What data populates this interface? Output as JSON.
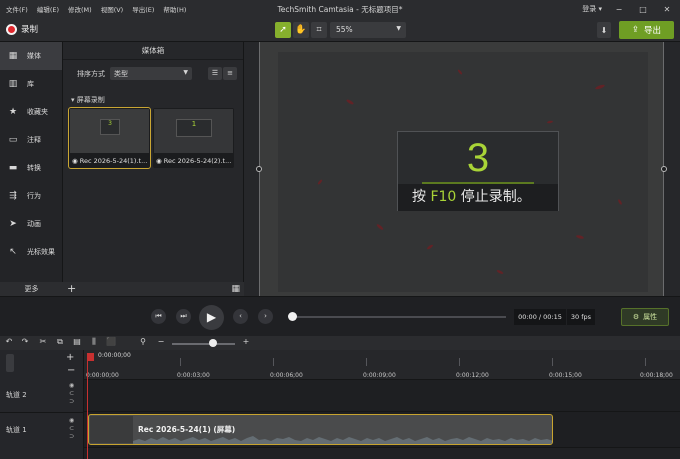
{
  "titlebar": {
    "menu": [
      "文件(F)",
      "编辑(E)",
      "修改(M)",
      "视图(V)",
      "导出(E)",
      "帮助(H)"
    ],
    "title": "TechSmith Camtasia - 无标题项目*",
    "login": "登录",
    "login_caret": "▾",
    "window_buttons": [
      "−",
      "□",
      "✕"
    ]
  },
  "toolbar": {
    "record_label": "录制",
    "zoom_value": "55%",
    "download_icon": "⬇",
    "export_label": "导出",
    "export_icon": "⇪"
  },
  "leftnav": {
    "items": [
      {
        "label": "媒体",
        "icon": "film-icon",
        "glyph": "▦"
      },
      {
        "label": "库",
        "icon": "library-icon",
        "glyph": "▥"
      },
      {
        "label": "收藏夹",
        "icon": "star-icon",
        "glyph": "★"
      },
      {
        "label": "注释",
        "icon": "callout-icon",
        "glyph": "▭"
      },
      {
        "label": "转换",
        "icon": "transition-icon",
        "glyph": "▬"
      },
      {
        "label": "行为",
        "icon": "behavior-icon",
        "glyph": "⇶"
      },
      {
        "label": "动画",
        "icon": "animation-icon",
        "glyph": "➤"
      },
      {
        "label": "光标效果",
        "icon": "cursor-effect-icon",
        "glyph": "↖"
      }
    ],
    "more_label": "更多",
    "add_glyph": "+",
    "grid_glyph": "▦"
  },
  "bin": {
    "header": "媒体箱",
    "sort_label": "排序方式",
    "sort_value": "类型",
    "section_label": "屏幕录制",
    "thumbs": [
      {
        "caption": "◉ Rec 2026-5-24(1).t...",
        "inner_num": "3"
      },
      {
        "caption": "◉ Rec 2026-5-24(2).t...",
        "inner_num": "1"
      }
    ]
  },
  "canvas": {
    "countdown_number": "3",
    "msg_prefix": "按 ",
    "msg_key": "F10",
    "msg_suffix": " 停止录制。"
  },
  "playback": {
    "time": "00:00 / 00:15",
    "fps": "30 fps",
    "properties_label": "属性",
    "progress": 0
  },
  "timeline": {
    "playhead_time": "0:00:00;00",
    "ticks": [
      "0:00:00;00",
      "0:00:03;00",
      "0:00:06;00",
      "0:00:09;00",
      "0:00:12;00",
      "0:00:15;00",
      "0:00:18;00"
    ],
    "tracks": [
      {
        "label": "轨道 2"
      },
      {
        "label": "轨道 1"
      }
    ],
    "clip_name": "Rec 2026-5-24(1) (屏幕)"
  },
  "colors": {
    "accent_green": "#86b02d",
    "record_red": "#e0282e",
    "selection_gold": "#c8a42f"
  }
}
